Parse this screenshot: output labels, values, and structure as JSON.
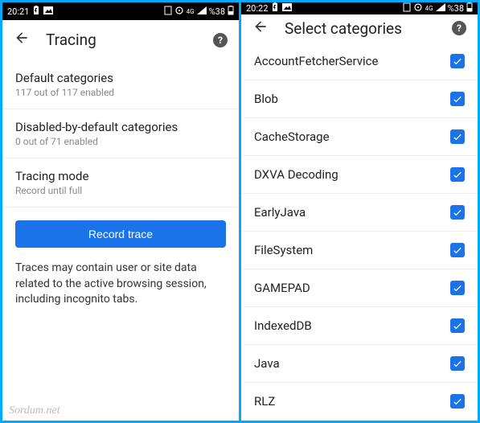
{
  "left": {
    "status": {
      "time": "20:21",
      "battery_text": "%38"
    },
    "title": "Tracing",
    "rows": [
      {
        "label": "Default categories",
        "sub": "117 out of 117 enabled"
      },
      {
        "label": "Disabled-by-default categories",
        "sub": "0 out of 71 enabled"
      },
      {
        "label": "Tracing mode",
        "sub": "Record until full"
      }
    ],
    "record_button": "Record trace",
    "note": "Traces may contain user or site data related to the active browsing session, including incognito tabs.",
    "watermark": "Sordum.net"
  },
  "right": {
    "status": {
      "time": "20:22",
      "battery_text": "%38"
    },
    "title": "Select categories",
    "categories": [
      {
        "label": "AccountFetcherService",
        "checked": true
      },
      {
        "label": "Blob",
        "checked": true
      },
      {
        "label": "CacheStorage",
        "checked": true
      },
      {
        "label": "DXVA Decoding",
        "checked": true
      },
      {
        "label": "EarlyJava",
        "checked": true
      },
      {
        "label": "FileSystem",
        "checked": true
      },
      {
        "label": "GAMEPAD",
        "checked": true
      },
      {
        "label": "IndexedDB",
        "checked": true
      },
      {
        "label": "Java",
        "checked": true
      },
      {
        "label": "RLZ",
        "checked": true
      }
    ]
  }
}
